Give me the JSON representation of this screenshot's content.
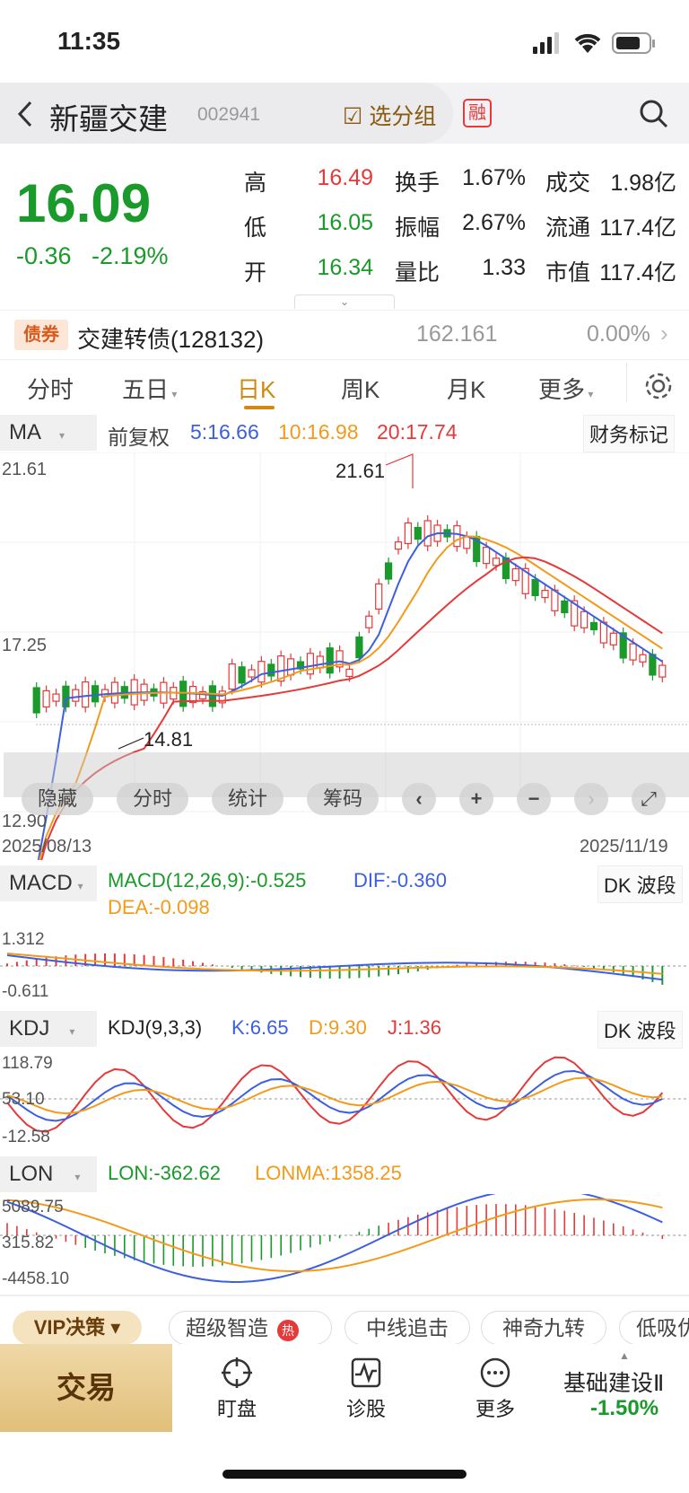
{
  "status": {
    "time": "11:35"
  },
  "header": {
    "title": "新疆交建",
    "code": "002941",
    "watch_label": "选分组",
    "margin_badge": "融"
  },
  "quote": {
    "price": "16.09",
    "change": "-0.36",
    "change_pct": "-2.19%",
    "rows": [
      {
        "l1": "高",
        "v1": "16.49",
        "l2": "换手",
        "v2": "1.67%",
        "l3": "成交",
        "v3": "1.98亿"
      },
      {
        "l1": "低",
        "v1": "16.05",
        "l2": "振幅",
        "v2": "2.67%",
        "l3": "流通",
        "v3": "117.4亿"
      },
      {
        "l1": "开",
        "v1": "16.34",
        "l2": "量比",
        "v2": "1.33",
        "l3": "市值",
        "v3": "117.4亿"
      }
    ]
  },
  "bond": {
    "badge": "债券",
    "name": "交建转债(128132)",
    "price": "162.161",
    "change": "0.00%"
  },
  "tabs": {
    "items": [
      "分时",
      "五日",
      "日K",
      "周K",
      "月K",
      "更多"
    ],
    "active": "日K"
  },
  "ma": {
    "label": "MA",
    "adjust": "前复权",
    "ma5": "5:16.66",
    "ma10": "10:16.98",
    "ma20": "20:17.74",
    "fin_mark": "财务标记"
  },
  "kline": {
    "ytop": "21.61",
    "ymid": "17.25",
    "ybot": "12.90",
    "high_mark": "21.61",
    "low_mark": "14.81",
    "date_start": "2025/08/13",
    "date_end": "2025/11/19",
    "buttons": [
      "隐藏",
      "分时",
      "统计",
      "筹码"
    ]
  },
  "macd": {
    "label": "MACD",
    "macd": "MACD(12,26,9):-0.525",
    "dif": "DIF:-0.360",
    "dea": "DEA:-0.098",
    "y1": "1.312",
    "y2": "-0.611",
    "wave": "DK 波段"
  },
  "kdj": {
    "label": "KDJ",
    "kdj": "KDJ(9,3,3)",
    "k": "K:6.65",
    "d": "D:9.30",
    "j": "J:1.36",
    "y1": "118.79",
    "y2": "53.10",
    "y3": "-12.58",
    "wave": "DK 波段"
  },
  "lon": {
    "label": "LON",
    "lon": "LON:-362.62",
    "lonma": "LONMA:1358.25",
    "y1": "5089.75",
    "y2": "315.82",
    "y3": "-4458.10"
  },
  "strategy": {
    "vip": "VIP决策",
    "chips": [
      "超级智造",
      "中线追击",
      "神奇九转",
      "低吸优"
    ],
    "hot": "热"
  },
  "bottom": {
    "trade": "交易",
    "items": [
      "盯盘",
      "诊股",
      "更多"
    ],
    "sector": "基础建设Ⅱ",
    "sector_change": "-1.50%"
  },
  "colors": {
    "up": "#e5393a",
    "down": "#1a9a2a",
    "ma5": "#3b5fe0",
    "ma10": "#f39a1a",
    "ma20": "#e5393a"
  }
}
